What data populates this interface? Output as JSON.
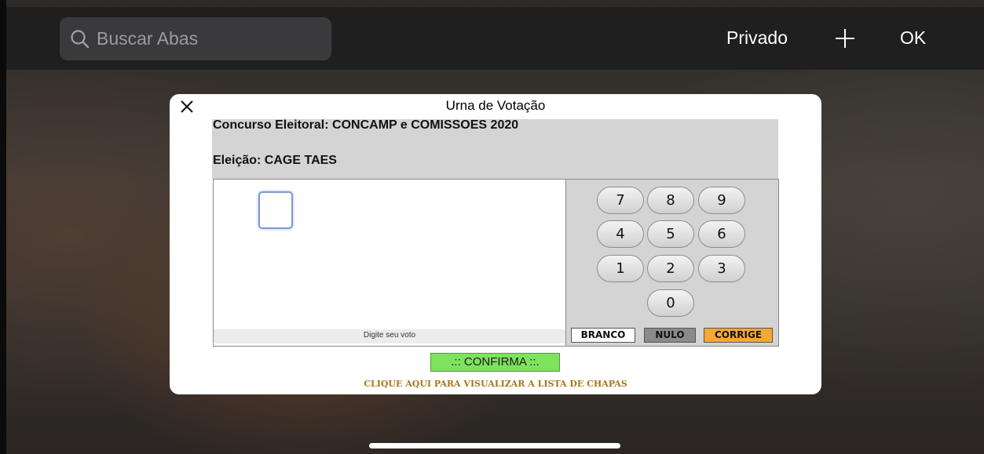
{
  "browser": {
    "search": {
      "placeholder": "Buscar Abas",
      "value": ""
    },
    "private_label": "Privado",
    "new_tab_icon": "plus-icon",
    "done_label": "OK"
  },
  "modal": {
    "title": "Urna de Votação",
    "close_icon": "close-icon",
    "concurso": "Concurso Eleitoral: CONCAMP e COMISSOES 2020",
    "eleicao": "Eleição: CAGE TAES",
    "digit_value": "",
    "vote_hint": "Digite seu voto",
    "keypad": {
      "k7": "7",
      "k8": "8",
      "k9": "9",
      "k4": "4",
      "k5": "5",
      "k6": "6",
      "k1": "1",
      "k2": "2",
      "k3": "3",
      "k0": "0"
    },
    "branco": "BRANCO",
    "nulo": "NULO",
    "corrige": "CORRIGE",
    "confirma": ".:: CONFIRMA ::.",
    "lista_link": "CLIQUE AQUI PARA VISUALIZAR A LISTA DE CHAPAS",
    "colors": {
      "branco": "#ffffff",
      "nulo": "#8a8a8a",
      "corrige": "#f5a833",
      "confirma": "#7fe25f",
      "link": "#a8761a"
    }
  }
}
